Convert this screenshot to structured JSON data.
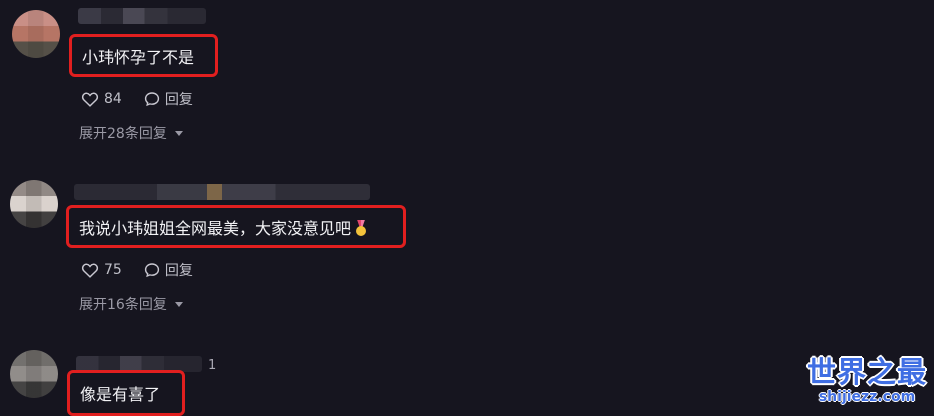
{
  "comments": [
    {
      "text": "小玮怀孕了不是",
      "likes": "84",
      "reply_label": "回复",
      "expand_label": "展开28条回复"
    },
    {
      "text": "我说小玮姐姐全网最美，大家没意见吧",
      "likes": "75",
      "reply_label": "回复",
      "expand_label": "展开16条回复"
    },
    {
      "text": "像是有喜了",
      "count": "1"
    }
  ],
  "watermark": {
    "title": "世界之最",
    "url": "shijiezz.com"
  },
  "colors": {
    "background": "#16151f",
    "highlight_border": "#e11f1f",
    "watermark": "#3f6ee3"
  }
}
